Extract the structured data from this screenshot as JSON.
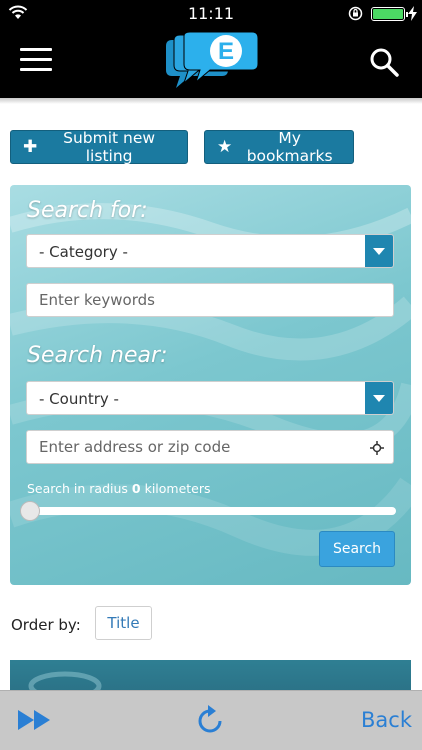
{
  "status_bar": {
    "time": "11:11"
  },
  "header": {
    "logo_letter": "E"
  },
  "actions": {
    "submit_label": "Submit new listing",
    "bookmarks_label": "My bookmarks"
  },
  "search_panel": {
    "search_for_heading": "Search for:",
    "category_select": "- Category -",
    "keywords_placeholder": "Enter keywords",
    "search_near_heading": "Search near:",
    "country_select": "- Country -",
    "address_placeholder": "Enter address or zip code",
    "radius_prefix": "Search in radius ",
    "radius_value": "0",
    "radius_suffix": " kilometers",
    "search_button": "Search"
  },
  "order": {
    "label": "Order by:",
    "title_button": "Title"
  },
  "bottom_bar": {
    "back_label": "Back"
  },
  "colors": {
    "accent": "#1b7aa0",
    "link": "#2a7fd4",
    "panel": "#7cc7cf"
  }
}
